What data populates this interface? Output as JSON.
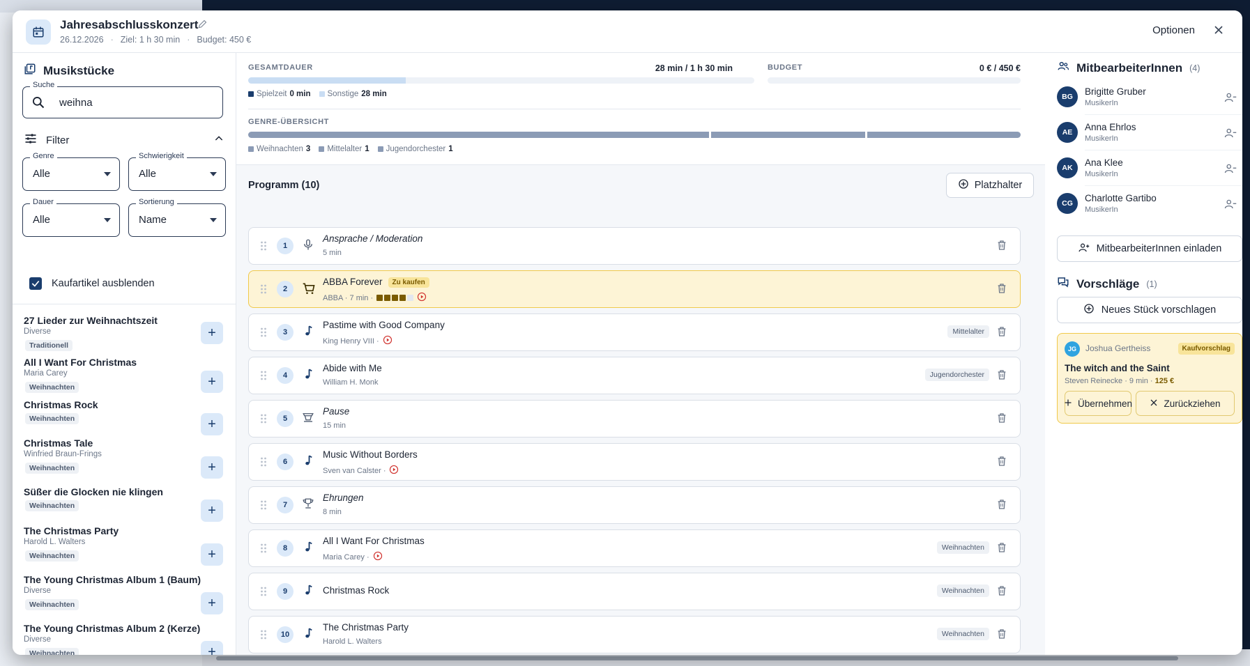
{
  "header": {
    "title": "Jahresabschlusskonzert",
    "date": "26.12.2026",
    "goal": "Ziel: 1 h 30 min",
    "budget": "Budget: 450 €",
    "options_label": "Optionen"
  },
  "library": {
    "title": "Musikstücke",
    "search_label": "Suche",
    "search_value": "weihna",
    "filter_label": "Filter",
    "selects": {
      "genre": {
        "label": "Genre",
        "value": "Alle"
      },
      "difficulty": {
        "label": "Schwierigkeit",
        "value": "Alle"
      },
      "duration": {
        "label": "Dauer",
        "value": "Alle"
      },
      "sort": {
        "label": "Sortierung",
        "value": "Name"
      }
    },
    "hide_purchase_label": "Kaufartikel ausblenden",
    "items": [
      {
        "name": "27 Lieder zur Weihnachtszeit",
        "composer": "Diverse",
        "tag": "Traditionell"
      },
      {
        "name": "All I Want For Christmas",
        "composer": "Maria Carey",
        "tag": "Weihnachten"
      },
      {
        "name": "Christmas Rock",
        "composer": "",
        "tag": "Weihnachten"
      },
      {
        "name": "Christmas Tale",
        "composer": "Winfried Braun-Frings",
        "tag": "Weihnachten"
      },
      {
        "name": "Süßer die Glocken nie klingen",
        "composer": "",
        "tag": "Weihnachten"
      },
      {
        "name": "The Christmas Party",
        "composer": "Harold L. Walters",
        "tag": "Weihnachten"
      },
      {
        "name": "The Young Christmas Album 1 (Baum)",
        "composer": "Diverse",
        "tag": "Weihnachten"
      },
      {
        "name": "The Young Christmas Album 2 (Kerze)",
        "composer": "Diverse",
        "tag": "Weihnachten"
      }
    ],
    "add_symbol": "+"
  },
  "stats": {
    "duration_label": "GESAMTDAUER",
    "duration_value": "28 min / 1 h 30 min",
    "duration_fraction": 0.311,
    "budget_label": "BUDGET",
    "budget_value": "0 € / 450 €",
    "budget_fraction": 0,
    "legend": [
      {
        "label": "Spielzeit",
        "value": "0 min",
        "color": "#1a3d6d"
      },
      {
        "label": "Sonstige",
        "value": "28 min",
        "color": "#c9ddf3"
      }
    ],
    "genre_label": "GENRE-ÜBERSICHT",
    "genres": [
      {
        "label": "Weihnachten",
        "value": "3",
        "count": 3
      },
      {
        "label": "Mittelalter",
        "value": "1",
        "count": 1
      },
      {
        "label": "Jugendorchester",
        "value": "1",
        "count": 1
      }
    ],
    "genre_color": "#8b9bb5"
  },
  "program": {
    "title": "Programm (10)",
    "placeholder_button": "Platzhalter",
    "rows": [
      {
        "num": "1",
        "title": "Ansprache / Moderation",
        "sub": "5 min",
        "italic": true,
        "icon": "microphone-icon",
        "tag": ""
      },
      {
        "num": "2",
        "title": "ABBA Forever",
        "badge": "Zu kaufen",
        "sub": "ABBA · 7 min ·",
        "italic": false,
        "icon": "cart-icon",
        "tag": "",
        "difficulty": 4,
        "play": true,
        "highlight": true
      },
      {
        "num": "3",
        "title": "Pastime with Good Company",
        "sub": "King Henry VIII ·",
        "italic": false,
        "icon": "music-note-icon",
        "tag": "Mittelalter",
        "play": true
      },
      {
        "num": "4",
        "title": "Abide with Me",
        "sub": "William H. Monk",
        "italic": false,
        "icon": "music-note-icon",
        "tag": "Jugendorchester"
      },
      {
        "num": "5",
        "title": "Pause",
        "sub": "15 min",
        "italic": true,
        "icon": "coffee-icon",
        "tag": ""
      },
      {
        "num": "6",
        "title": "Music Without Borders",
        "sub": "Sven van Calster ·",
        "italic": false,
        "icon": "music-note-icon",
        "tag": "",
        "play": true
      },
      {
        "num": "7",
        "title": "Ehrungen",
        "sub": "8 min",
        "italic": true,
        "icon": "trophy-icon",
        "tag": ""
      },
      {
        "num": "8",
        "title": "All I Want For Christmas",
        "sub": "Maria Carey ·",
        "italic": false,
        "icon": "music-note-icon",
        "tag": "Weihnachten",
        "play": true
      },
      {
        "num": "9",
        "title": "Christmas Rock",
        "sub": "",
        "italic": false,
        "icon": "music-note-icon",
        "tag": "Weihnachten"
      },
      {
        "num": "10",
        "title": "The Christmas Party",
        "sub": "Harold L. Walters",
        "italic": false,
        "icon": "music-note-icon",
        "tag": "Weihnachten"
      }
    ]
  },
  "collaborators": {
    "title": "MitbearbeiterInnen",
    "count": "(4)",
    "members": [
      {
        "initials": "BG",
        "name": "Brigitte Gruber",
        "role": "MusikerIn"
      },
      {
        "initials": "AE",
        "name": "Anna Ehrlos",
        "role": "MusikerIn"
      },
      {
        "initials": "AK",
        "name": "Ana Klee",
        "role": "MusikerIn"
      },
      {
        "initials": "CG",
        "name": "Charlotte Gartibo",
        "role": "MusikerIn"
      }
    ],
    "invite_label": "MitbearbeiterInnen einladen"
  },
  "suggestions": {
    "title": "Vorschläge",
    "count": "(1)",
    "new_label": "Neues Stück vorschlagen",
    "item": {
      "initials": "JG",
      "author": "Joshua Gertheiss",
      "badge": "Kaufvorschlag",
      "title": "The witch and the Saint",
      "meta": "Steven Reinecke · 9 min ·",
      "price": "125 €",
      "accept_label": "Übernehmen",
      "withdraw_label": "Zurückziehen"
    }
  }
}
